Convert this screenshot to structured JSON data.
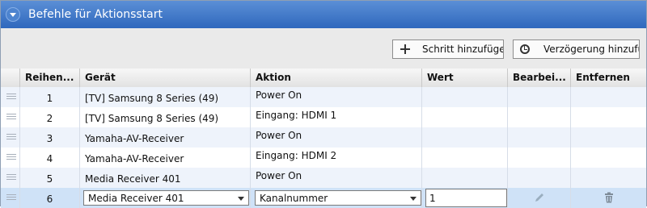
{
  "panel": {
    "title": "Befehle für Aktionsstart"
  },
  "toolbar": {
    "add_step_label": "Schritt hinzufügen",
    "add_delay_label": "Verzögerung hinzufüg"
  },
  "table": {
    "columns": [
      "Reihen...",
      "Gerät",
      "Aktion",
      "Wert",
      "Bearbei...",
      "Entfernen"
    ],
    "rows": [
      {
        "order": "1",
        "device": "[TV] Samsung 8 Series (49)",
        "action": "Power On",
        "value": ""
      },
      {
        "order": "2",
        "device": "[TV] Samsung 8 Series (49)",
        "action": "Eingang: HDMI 1",
        "value": ""
      },
      {
        "order": "3",
        "device": "Yamaha-AV-Receiver",
        "action": "Power On",
        "value": ""
      },
      {
        "order": "4",
        "device": "Yamaha-AV-Receiver",
        "action": "Eingang: HDMI 2",
        "value": ""
      },
      {
        "order": "5",
        "device": "Media Receiver 401",
        "action": "Power On",
        "value": ""
      }
    ],
    "edit_row": {
      "order": "6",
      "device_selected": "Media Receiver 401",
      "action_selected": "Kanalnummer",
      "value": "1"
    }
  },
  "icons": {
    "collapse": "chevron-down-icon",
    "add": "plus-icon",
    "delay": "clock-icon",
    "edit": "pencil-icon",
    "delete": "trash-icon",
    "drag": "drag-handle-icon"
  },
  "colors": {
    "header_blue": "#2f68bd",
    "selected_row": "#cfe2f7",
    "alt_row": "#eef3fb"
  }
}
